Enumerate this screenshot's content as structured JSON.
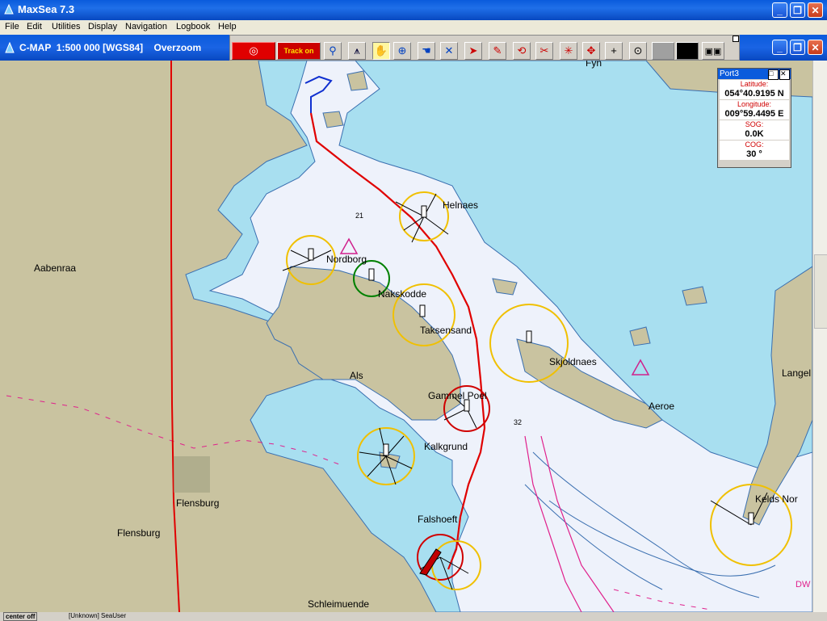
{
  "window": {
    "title": "MaxSea 7.3"
  },
  "menu": [
    "File",
    "Edit",
    "Utilities",
    "Display",
    "Navigation",
    "Logbook",
    "Help"
  ],
  "chart_window": {
    "title": "C-MAP  1:500 000 [WGS84]    Overzoom"
  },
  "toolbar": {
    "track_label": "Track on"
  },
  "port_panel": {
    "title": "Port3",
    "latitude_label": "Latitude:",
    "latitude": "054°40.9195 N",
    "longitude_label": "Longitude:",
    "longitude": "009°59.4495 E",
    "sog_label": "SOG:",
    "sog": "0.0K",
    "cog_label": "COG:",
    "cog": "30 °"
  },
  "map_labels": {
    "fyn": "Fyn",
    "helnaes": "Helnaes",
    "nordborg": "Nordborg",
    "nakskov": "Nakskodde",
    "taksensand": "Taksensand",
    "skjoldnaes": "Skjoldnaes",
    "aabenraa": "Aabenraa",
    "als": "Als",
    "gammel_poel": "Gammel Poel",
    "kalkgrund": "Kalkgrund",
    "aeroe": "Aeroe",
    "langel": "Langel",
    "flensburg1": "Flensburg",
    "flensburg2": "Flensburg",
    "falshoeft": "Falshoeft",
    "schleimuende": "Schleimuende",
    "keldsnor": "Kelds Nor",
    "sounding_21": "21",
    "sounding_32": "32",
    "dw": "DW"
  },
  "status": {
    "center": "center off",
    "user": "[Unknown] SeaUser"
  },
  "colors": {
    "land": "#c9c3a0",
    "shallow": "#a8dff0",
    "deep": "#eef2fb",
    "track": "#e00000",
    "contour": "#3a6fb0",
    "light_ring": "#f0c000"
  }
}
